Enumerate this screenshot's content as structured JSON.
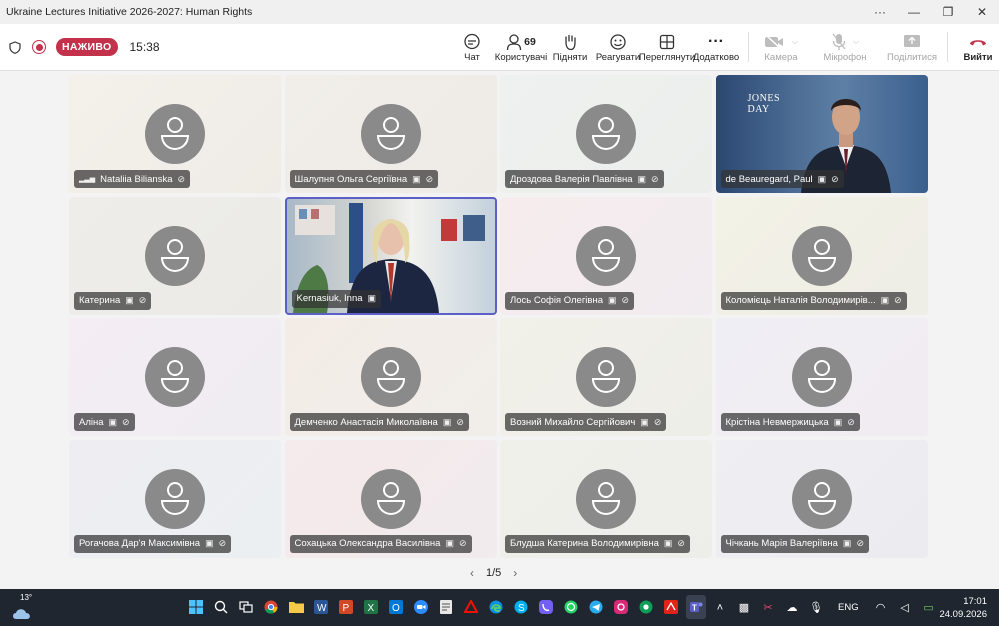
{
  "window": {
    "title": "Ukraine Lectures Initiative 2026-2027: Human Rights",
    "controls": [
      "more-icon",
      "minimize-icon",
      "restore-icon",
      "close-icon"
    ]
  },
  "toolbar": {
    "live_label": "НАЖИВО",
    "elapsed": "15:38",
    "participant_count": "69",
    "buttons": {
      "chat": "Чат",
      "people": "Користувачі",
      "raise": "Підняти",
      "react": "Реагувати",
      "view": "Переглянути",
      "more": "Додатково",
      "camera": "Камера",
      "mic": "Мікрофон",
      "share": "Поділитися",
      "leave": "Вийти"
    },
    "accent": "#c4314b"
  },
  "participants": [
    {
      "name": "Nataliia Bilianska",
      "icons": [
        "signal-icon",
        "mic-off-icon"
      ]
    },
    {
      "name": "Шалупня Ольга Сергіївна",
      "icons": [
        "camera-off-icon",
        "mic-off-icon"
      ]
    },
    {
      "name": "Дроздова Валерія Павлівна",
      "icons": [
        "camera-off-icon",
        "mic-off-icon"
      ]
    },
    {
      "name": "de Beauregard, Paul",
      "icons": [
        "camera-icon",
        "mic-off-icon"
      ],
      "video": true,
      "logo": "JONES DAY"
    },
    {
      "name": "Катерина",
      "icons": [
        "camera-off-icon",
        "mic-off-icon"
      ]
    },
    {
      "name": "Kernasiuk, Inna",
      "icons": [
        "camera-icon"
      ],
      "video": true,
      "speaking": true
    },
    {
      "name": "Лось Софія Олегівна",
      "icons": [
        "camera-off-icon",
        "mic-off-icon"
      ]
    },
    {
      "name": "Коломієць Наталія Володимирів...",
      "icons": [
        "camera-off-icon",
        "mic-off-icon"
      ]
    },
    {
      "name": "Аліна",
      "icons": [
        "camera-off-icon",
        "mic-off-icon"
      ]
    },
    {
      "name": "Демченко Анастасія Миколаївна",
      "icons": [
        "camera-off-icon",
        "mic-off-icon"
      ]
    },
    {
      "name": "Возний Михайло Сергійович",
      "icons": [
        "camera-off-icon",
        "mic-off-icon"
      ]
    },
    {
      "name": "Крістіна Невмержицька",
      "icons": [
        "camera-off-icon",
        "mic-off-icon"
      ]
    },
    {
      "name": "Рогачова Дар'я Максимівна",
      "icons": [
        "camera-off-icon",
        "mic-off-icon"
      ]
    },
    {
      "name": "Сохацька Олександра Василівна",
      "icons": [
        "camera-off-icon",
        "mic-off-icon"
      ]
    },
    {
      "name": "Блудша Катерина Володимирівна",
      "icons": [
        "camera-off-icon",
        "mic-off-icon"
      ]
    },
    {
      "name": "Чічкань Марія Валеріївна",
      "icons": [
        "camera-off-icon",
        "mic-off-icon"
      ]
    }
  ],
  "pager": {
    "label": "1/5"
  },
  "taskbar": {
    "weather_temp": "13°",
    "language": "ENG",
    "time": "17:01",
    "date": "24.09.2026"
  }
}
